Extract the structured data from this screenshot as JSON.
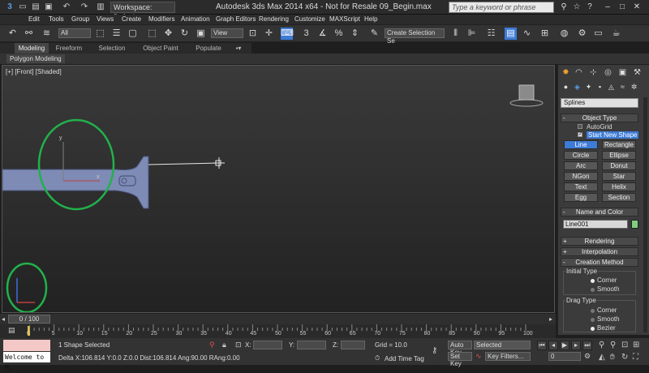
{
  "titlebar": {
    "title": "Autodesk 3ds Max  2014 x64   -  Not for Resale    09_Begin.max",
    "workspace_label": "Workspace: Default",
    "search_placeholder": "Type a keyword or phrase"
  },
  "menu": [
    "Edit",
    "Tools",
    "Group",
    "Views",
    "Create",
    "Modifiers",
    "Animation",
    "Graph Editors",
    "Rendering",
    "Customize",
    "MAXScript",
    "Help"
  ],
  "toolbar": {
    "selection_filter": "All",
    "ref_coord": "View",
    "named_selection": "Create Selection Se"
  },
  "ribbon": {
    "tabs": [
      "Modeling",
      "Freeform",
      "Selection",
      "Object Paint",
      "Populate"
    ],
    "active_button": "Polygon Modeling"
  },
  "viewport": {
    "label": "[+] [Front] [Shaded]",
    "axis_x": "x",
    "axis_y": "y"
  },
  "command_panel": {
    "category": "Splines",
    "object_type_title": "Object Type",
    "autogrid_label": "AutoGrid",
    "start_new_shape_label": "Start New Shape",
    "buttons": [
      "Line",
      "Rectangle",
      "Circle",
      "Ellipse",
      "Arc",
      "Donut",
      "NGon",
      "Star",
      "Text",
      "Helix",
      "Egg",
      "Section"
    ],
    "active_button": "Line",
    "name_color_title": "Name and Color",
    "object_name": "Line001",
    "object_color": "#7ecf7e",
    "rollouts": [
      "Rendering",
      "Interpolation",
      "Creation Method"
    ],
    "initial_type_title": "Initial Type",
    "initial_type_options": [
      "Corner",
      "Smooth"
    ],
    "initial_type_selected": "Corner",
    "drag_type_title": "Drag Type",
    "drag_type_options": [
      "Corner",
      "Smooth",
      "Bezier"
    ],
    "drag_type_selected": "Bezier"
  },
  "timeline": {
    "slider_label": "0 / 100",
    "ticks": [
      "0",
      "5",
      "10",
      "15",
      "20",
      "25",
      "30",
      "35",
      "40",
      "45",
      "50",
      "55",
      "60",
      "65",
      "70",
      "75",
      "80",
      "85",
      "90",
      "95",
      "100"
    ]
  },
  "status": {
    "maxscript_listener": "Welcome to M.",
    "selection_info": "1 Shape Selected",
    "prompt": "Delta X:106.814  Y:0.0  Z:0.0  Dist:106.814  Ang:90.00  RAng:0.00",
    "x_label": "X:",
    "y_label": "Y:",
    "z_label": "Z:",
    "grid": "Grid = 10.0",
    "add_time_tag": "Add Time Tag",
    "auto_key": "Auto Key",
    "set_key": "Set Key",
    "selected_dropdown": "Selected",
    "key_filters": "Key Filters...",
    "frame": "0"
  },
  "colors": {
    "accent": "#3d7bd6",
    "annotation_circle": "#22b14c"
  }
}
